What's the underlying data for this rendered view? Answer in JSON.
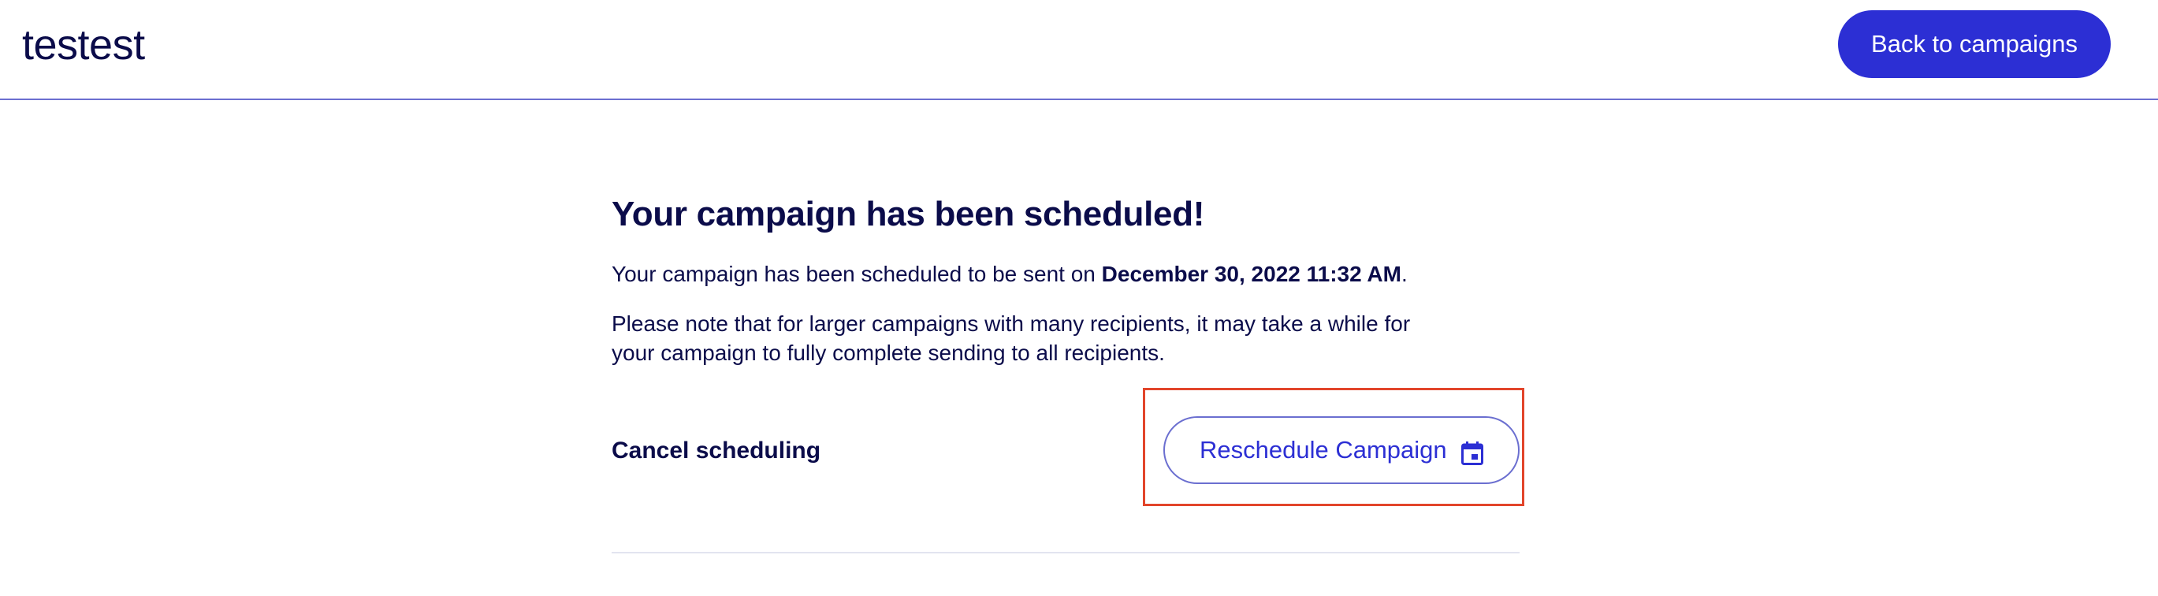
{
  "header": {
    "title": "testest",
    "back_button_label": "Back to campaigns"
  },
  "main": {
    "heading": "Your campaign has been scheduled!",
    "scheduled_prefix": "Your campaign has been scheduled to be sent on ",
    "scheduled_datetime": "December 30, 2022 11:32 AM",
    "scheduled_suffix": ".",
    "note": "Please note that for larger campaigns with many recipients, it may take a while for your campaign to fully complete sending to all recipients.",
    "cancel_label": "Cancel scheduling",
    "reschedule_label": "Reschedule Campaign",
    "reschedule_icon": "calendar-icon"
  },
  "colors": {
    "primary": "#2c2fd4",
    "text": "#0b0c4a",
    "highlight": "#e2452b",
    "divider": "#e2e4f0"
  }
}
